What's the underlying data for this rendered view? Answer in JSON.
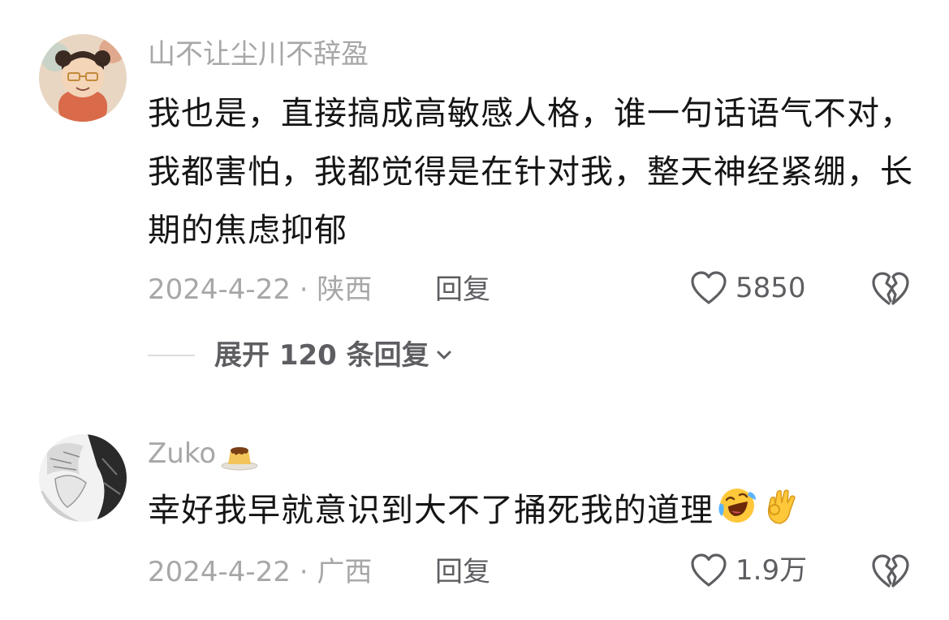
{
  "comments": [
    {
      "username": "山不让尘川不辞盈",
      "text": "我也是，直接搞成高敏感人格，谁一句话语气不对，我都害怕，我都觉得是在针对我，整天神经紧绷，长期的焦虑抑郁",
      "date_location": "2024-4-22 · 陕西",
      "reply_label": "回复",
      "like_count": "5850",
      "expand_label": "展开 120 条回复",
      "avatar_icon": "cartoon-girl-avatar"
    },
    {
      "username": "Zuko",
      "username_badge_icon": "pudding-icon",
      "text": "幸好我早就意识到大不了捅死我的道理",
      "emojis": [
        "laughing-crying-emoji",
        "ok-hand-emoji"
      ],
      "date_location": "2024-4-22 · 广西",
      "reply_label": "回复",
      "like_count": "1.9万",
      "avatar_icon": "manga-character-avatar"
    }
  ],
  "colors": {
    "primary_text": "#151515",
    "secondary_text": "#a7a7a9",
    "action_text": "#5e5e62"
  }
}
